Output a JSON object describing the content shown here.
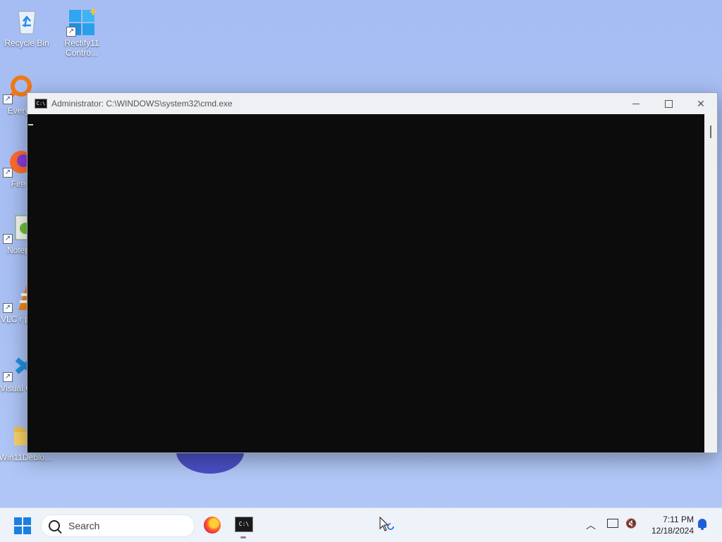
{
  "desktop": {
    "icons": [
      {
        "label": "Recycle Bin",
        "icon": "recycle-bin-icon"
      },
      {
        "label": "Rectify11 Contro...",
        "icon": "rectify11-control-icon"
      },
      {
        "label": "Every",
        "icon": "everything-search-icon"
      },
      {
        "label": "Fire",
        "icon": "firefox-icon"
      },
      {
        "label": "Notep",
        "icon": "notepad-icon"
      },
      {
        "label": "VLC r pla",
        "icon": "vlc-icon"
      },
      {
        "label": "Visual Co",
        "icon": "vscode-icon"
      },
      {
        "label": "Win11Deblo...",
        "icon": "folder-icon"
      }
    ]
  },
  "window": {
    "title": "Administrator: C:\\WINDOWS\\system32\\cmd.exe",
    "icon_text": "C:\\",
    "buttons": [
      "minimize",
      "maximize",
      "close"
    ],
    "console_bg": "#0c0c0c"
  },
  "taskbar": {
    "search_placeholder": "Search",
    "cmd_icon_text": "C:\\",
    "time": "7:11 PM",
    "date": "12/18/2024",
    "accent": "#1b7fe0"
  }
}
